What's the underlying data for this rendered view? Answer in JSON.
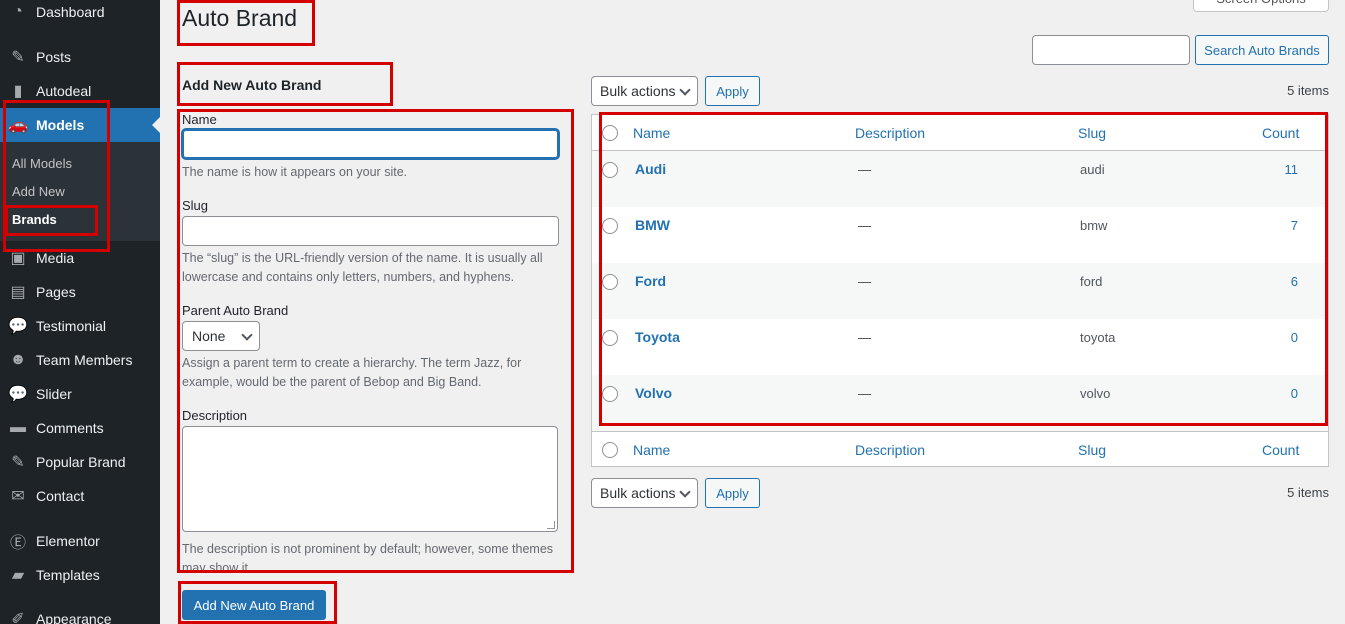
{
  "sidebar": {
    "items": [
      {
        "label": "Dashboard",
        "icon": "dashboard-icon",
        "glyph": "◔"
      },
      {
        "label": "Posts",
        "icon": "pin-icon",
        "glyph": "✎"
      },
      {
        "label": "Autodeal",
        "icon": "autodeal-icon",
        "glyph": "▮"
      },
      {
        "label": "Models",
        "icon": "car-icon",
        "glyph": "🚗"
      },
      {
        "label": "Media",
        "icon": "media-icon",
        "glyph": "▣"
      },
      {
        "label": "Pages",
        "icon": "pages-icon",
        "glyph": "▤"
      },
      {
        "label": "Testimonial",
        "icon": "comment-icon",
        "glyph": "💬"
      },
      {
        "label": "Team Members",
        "icon": "team-icon",
        "glyph": "☻"
      },
      {
        "label": "Slider",
        "icon": "comment-icon",
        "glyph": "💬"
      },
      {
        "label": "Comments",
        "icon": "comments-icon",
        "glyph": "▬"
      },
      {
        "label": "Popular Brand",
        "icon": "pin-icon",
        "glyph": "✎"
      },
      {
        "label": "Contact",
        "icon": "mail-icon",
        "glyph": "✉"
      },
      {
        "label": "Elementor",
        "icon": "elementor-icon",
        "glyph": "Ⓔ"
      },
      {
        "label": "Templates",
        "icon": "folder-icon",
        "glyph": "▰"
      },
      {
        "label": "Appearance",
        "icon": "brush-icon",
        "glyph": "✐"
      }
    ],
    "submenu": [
      "All Models",
      "Add New",
      "Brands"
    ]
  },
  "header": {
    "title": "Auto Brand",
    "screen_options": "Screen Options"
  },
  "form": {
    "heading": "Add New Auto Brand",
    "name_label": "Name",
    "name_value": "",
    "name_desc": "The name is how it appears on your site.",
    "slug_label": "Slug",
    "slug_value": "",
    "slug_desc": "The “slug” is the URL-friendly version of the name. It is usually all lowercase and contains only letters, numbers, and hyphens.",
    "parent_label": "Parent Auto Brand",
    "parent_value": "None",
    "parent_desc": "Assign a parent term to create a hierarchy. The term Jazz, for example, would be the parent of Bebop and Big Band.",
    "description_label": "Description",
    "description_desc": "The description is not prominent by default; however, some themes may show it.",
    "submit_label": "Add New Auto Brand"
  },
  "search": {
    "value": "",
    "button_label": "Search Auto Brands"
  },
  "bulk": {
    "label": "Bulk actions",
    "apply": "Apply",
    "items_count": "5 items"
  },
  "table": {
    "columns": {
      "name": "Name",
      "description": "Description",
      "slug": "Slug",
      "count": "Count"
    },
    "rows": [
      {
        "name": "Audi",
        "description": "—",
        "slug": "audi",
        "count": "11"
      },
      {
        "name": "BMW",
        "description": "—",
        "slug": "bmw",
        "count": "7"
      },
      {
        "name": "Ford",
        "description": "—",
        "slug": "ford",
        "count": "6"
      },
      {
        "name": "Toyota",
        "description": "—",
        "slug": "toyota",
        "count": "0"
      },
      {
        "name": "Volvo",
        "description": "—",
        "slug": "volvo",
        "count": "0"
      }
    ]
  },
  "colors": {
    "sidebar_bg": "#1d2327",
    "accent": "#2271b1",
    "annotation_red": "#d40000"
  }
}
